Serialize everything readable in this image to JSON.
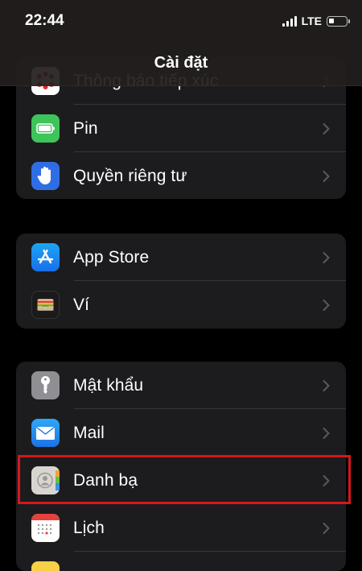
{
  "status": {
    "time": "22:44",
    "network": "LTE"
  },
  "header": {
    "title": "Cài đặt"
  },
  "groups": [
    {
      "items": [
        {
          "label": "Thông báo tiếp xúc",
          "icon": "exposure-notification-icon"
        },
        {
          "label": "Pin",
          "icon": "battery-icon"
        },
        {
          "label": "Quyền riêng tư",
          "icon": "privacy-hand-icon"
        }
      ]
    },
    {
      "items": [
        {
          "label": "App Store",
          "icon": "app-store-icon"
        },
        {
          "label": "Ví",
          "icon": "wallet-icon"
        }
      ]
    },
    {
      "items": [
        {
          "label": "Mật khẩu",
          "icon": "key-icon"
        },
        {
          "label": "Mail",
          "icon": "mail-icon"
        },
        {
          "label": "Danh bạ",
          "icon": "contacts-icon"
        },
        {
          "label": "Lịch",
          "icon": "calendar-icon"
        }
      ]
    }
  ],
  "colors": {
    "highlight": "#d9161b",
    "group_bg": "#1c1c1e",
    "chevron": "#5a5a5e"
  }
}
